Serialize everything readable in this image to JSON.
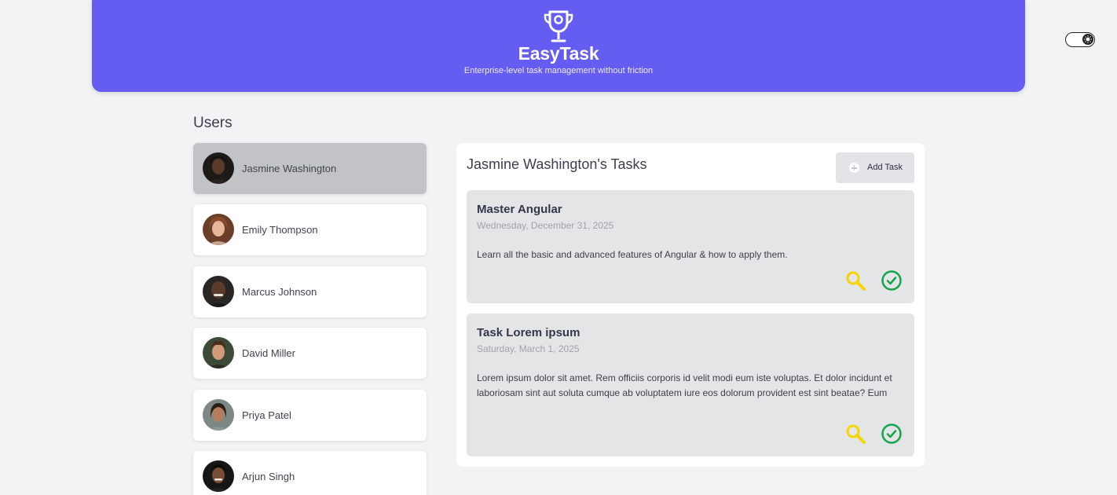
{
  "header": {
    "title": "EasyTask",
    "subtitle": "Enterprise-level task management without friction",
    "logo_icon": "trophy-icon",
    "background": "#655cf2"
  },
  "theme_toggle": {
    "icon": "sun-icon",
    "state": "on"
  },
  "users": {
    "heading": "Users",
    "selected_index": 0,
    "items": [
      {
        "name": "Jasmine Washington",
        "avatar": "avatar-photo"
      },
      {
        "name": "Emily Thompson",
        "avatar": "avatar-photo"
      },
      {
        "name": "Marcus Johnson",
        "avatar": "avatar-photo"
      },
      {
        "name": "David Miller",
        "avatar": "avatar-photo"
      },
      {
        "name": "Priya Patel",
        "avatar": "avatar-photo"
      },
      {
        "name": "Arjun Singh",
        "avatar": "avatar-photo"
      }
    ]
  },
  "tasks": {
    "title": "Jasmine Washington's Tasks",
    "add_label": "Add Task",
    "add_icon": "plus-circle-icon",
    "items": [
      {
        "title": "Master Angular",
        "date": "Wednesday, December 31, 2025",
        "description": "Learn all the basic and advanced features of Angular & how to apply them.",
        "view_icon": "magnifier-icon",
        "complete_icon": "check-circle-icon"
      },
      {
        "title": "Task Lorem ipsum",
        "date": "Saturday, March 1, 2025",
        "description": "Lorem ipsum dolor sit amet. Rem officiis corporis id velit modi eum iste voluptas. Et dolor incidunt et laboriosam sint aut soluta cumque ab voluptatem iure eos dolorum provident est sint beatae? Eum",
        "view_icon": "magnifier-icon",
        "complete_icon": "check-circle-icon"
      }
    ]
  },
  "colors": {
    "accent": "#655cf2",
    "view_icon": "#f5d400",
    "complete_icon": "#16a34a",
    "selected_user_bg": "#c2c3c7"
  }
}
